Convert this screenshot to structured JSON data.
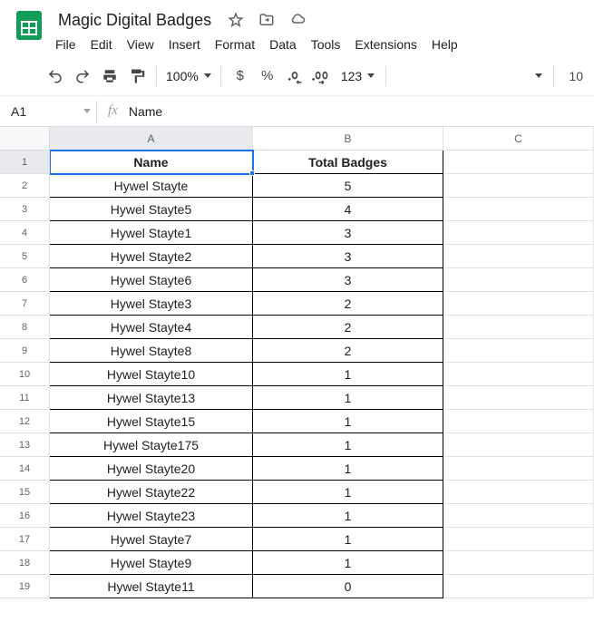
{
  "doc": {
    "title": "Magic Digital Badges"
  },
  "menu": {
    "file": "File",
    "edit": "Edit",
    "view": "View",
    "insert": "Insert",
    "format": "Format",
    "data": "Data",
    "tools": "Tools",
    "extensions": "Extensions",
    "help": "Help"
  },
  "toolbar": {
    "zoom": "100%",
    "currency": "$",
    "percent": "%",
    "fmt123": "123",
    "fontsize": "10"
  },
  "namebox": {
    "ref": "A1"
  },
  "formula": {
    "value": "Name"
  },
  "columns": {
    "A": "A",
    "B": "B",
    "C": "C"
  },
  "headers": {
    "name": "Name",
    "total": "Total Badges"
  },
  "rows": [
    {
      "n": "1",
      "name": "Name",
      "total": "Total Badges",
      "header": true
    },
    {
      "n": "2",
      "name": "Hywel Stayte",
      "total": "5"
    },
    {
      "n": "3",
      "name": "Hywel Stayte5",
      "total": "4"
    },
    {
      "n": "4",
      "name": "Hywel Stayte1",
      "total": "3"
    },
    {
      "n": "5",
      "name": "Hywel Stayte2",
      "total": "3"
    },
    {
      "n": "6",
      "name": "Hywel Stayte6",
      "total": "3"
    },
    {
      "n": "7",
      "name": "Hywel Stayte3",
      "total": "2"
    },
    {
      "n": "8",
      "name": "Hywel Stayte4",
      "total": "2"
    },
    {
      "n": "9",
      "name": "Hywel Stayte8",
      "total": "2"
    },
    {
      "n": "10",
      "name": "Hywel Stayte10",
      "total": "1"
    },
    {
      "n": "11",
      "name": "Hywel Stayte13",
      "total": "1"
    },
    {
      "n": "12",
      "name": "Hywel Stayte15",
      "total": "1"
    },
    {
      "n": "13",
      "name": "Hywel Stayte175",
      "total": "1"
    },
    {
      "n": "14",
      "name": "Hywel Stayte20",
      "total": "1"
    },
    {
      "n": "15",
      "name": "Hywel Stayte22",
      "total": "1"
    },
    {
      "n": "16",
      "name": "Hywel Stayte23",
      "total": "1"
    },
    {
      "n": "17",
      "name": "Hywel Stayte7",
      "total": "1"
    },
    {
      "n": "18",
      "name": "Hywel Stayte9",
      "total": "1"
    },
    {
      "n": "19",
      "name": "Hywel Stayte11",
      "total": "0"
    }
  ]
}
